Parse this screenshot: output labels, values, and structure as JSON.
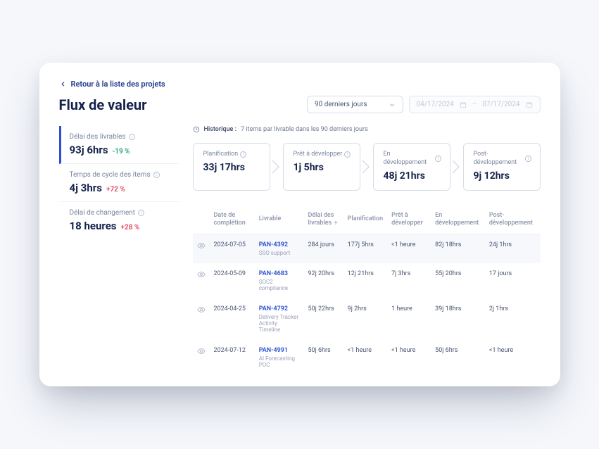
{
  "breadcrumb": {
    "back_label": "Retour à la liste des projets"
  },
  "page": {
    "title": "Flux de valeur"
  },
  "filters": {
    "range_label": "90 derniers jours",
    "date_from": "04/17/2024",
    "date_to": "07/17/2024"
  },
  "sidebar": {
    "metrics": [
      {
        "label": "Délai des livrables",
        "value": "93j 6hrs",
        "delta": "-19 %",
        "dir": "pos",
        "active": true
      },
      {
        "label": "Temps de cycle des items",
        "value": "4j 3hrs",
        "delta": "+72 %",
        "dir": "neg",
        "active": false
      },
      {
        "label": "Délai de changement",
        "value": "18 heures",
        "delta": "+28 %",
        "dir": "neg",
        "active": false
      }
    ]
  },
  "history": {
    "label": "Historique :",
    "text": "7 items par livrable dans les 90 derniers jours"
  },
  "stages": [
    {
      "title": "Planification",
      "value": "33j 17hrs"
    },
    {
      "title": "Prêt à développer",
      "value": "1j 5hrs"
    },
    {
      "title": "En développement",
      "value": "48j 21hrs"
    },
    {
      "title": "Post-développement",
      "value": "9j 12hrs"
    }
  ],
  "table": {
    "headers": {
      "date": "Date de complétion",
      "deliverable": "Livrable",
      "lead": "Délai des livrables",
      "planning": "Planification",
      "ready": "Prêt à développer",
      "dev": "En développement",
      "post": "Post-développement"
    },
    "rows": [
      {
        "date": "2024-07-05",
        "id": "PAN-4392",
        "sub": "SSO support",
        "lead": "284 jours",
        "planning": "177j 5hrs",
        "ready": "<1 heure",
        "dev": "82j 18hrs",
        "post": "24j 1hrs"
      },
      {
        "date": "2024-05-09",
        "id": "PAN-4683",
        "sub": "SOC2 compliance",
        "lead": "92j 20hrs",
        "planning": "12j 21hrs",
        "ready": "7j 3hrs",
        "dev": "55j 20hrs",
        "post": "17 jours"
      },
      {
        "date": "2024-04-25",
        "id": "PAN-4792",
        "sub": "Delivery Tracker Activity Timeline",
        "lead": "50j 22hrs",
        "planning": "9j 2hrs",
        "ready": "1 heure",
        "dev": "39j 18hrs",
        "post": "2j 1hrs"
      },
      {
        "date": "2024-07-12",
        "id": "PAN-4991",
        "sub": "AI Forecasting POC",
        "lead": "50j 6hrs",
        "planning": "<1 heure",
        "ready": "<1 heure",
        "dev": "50j 6hrs",
        "post": "<1 heure"
      }
    ]
  }
}
